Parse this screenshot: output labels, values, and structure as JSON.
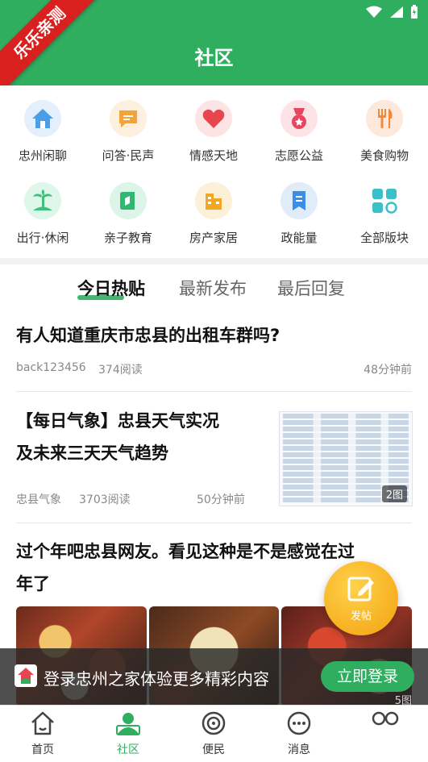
{
  "ribbon_text": "乐乐亲测",
  "header": {
    "title": "社区"
  },
  "categories": [
    {
      "label": "忠州闲聊",
      "icon": "house-icon",
      "color": "#4a9ee8"
    },
    {
      "label": "问答·民声",
      "icon": "chat-bubble-icon",
      "color": "#f2a33a"
    },
    {
      "label": "情感天地",
      "icon": "heart-icon",
      "color": "#e8464f"
    },
    {
      "label": "志愿公益",
      "icon": "medal-icon",
      "color": "#e8465f"
    },
    {
      "label": "美食购物",
      "icon": "fork-knife-icon",
      "color": "#f08a3a"
    },
    {
      "label": "出行·休闲",
      "icon": "palm-tree-icon",
      "color": "#3cc07a"
    },
    {
      "label": "亲子教育",
      "icon": "book-icon",
      "color": "#2fb870"
    },
    {
      "label": "房产家居",
      "icon": "building-icon",
      "color": "#f5a623"
    },
    {
      "label": "政能量",
      "icon": "bookmark-icon",
      "color": "#3a8ee8"
    },
    {
      "label": "全部版块",
      "icon": "grid-icon",
      "color": "#3cc0c8"
    }
  ],
  "tabs": [
    {
      "label": "今日热贴",
      "active": true
    },
    {
      "label": "最新发布",
      "active": false
    },
    {
      "label": "最后回复",
      "active": false
    }
  ],
  "posts": [
    {
      "title": "有人知道重庆市忠县的出租车群吗?",
      "author": "back123456",
      "reads": "374阅读",
      "time": "48分钟前"
    },
    {
      "title_line1": "【每日气象】忠县天气实况",
      "title_line2": "及未来三天天气趋势",
      "author": "忠县气象",
      "reads": "3703阅读",
      "time": "50分钟前",
      "image_count": "2图"
    },
    {
      "title_line1": "过个年吧忠县网友。看见这种是不是感觉在过",
      "title_line2": "年了",
      "image_count": "5图"
    }
  ],
  "fab": {
    "label": "发帖"
  },
  "login_banner": {
    "text": "登录忠州之家体验更多精彩内容",
    "button": "立即登录"
  },
  "bottom_nav": [
    {
      "label": "首页",
      "icon": "home-icon",
      "active": false
    },
    {
      "label": "社区",
      "icon": "community-icon",
      "active": true
    },
    {
      "label": "便民",
      "icon": "service-icon",
      "active": false
    },
    {
      "label": "消息",
      "icon": "message-icon",
      "active": false
    },
    {
      "label": "",
      "icon": "profile-icon",
      "active": false
    }
  ],
  "colors": {
    "brand": "#2fae5f",
    "fab": "#f3a10f",
    "ribbon": "#d8211f"
  }
}
